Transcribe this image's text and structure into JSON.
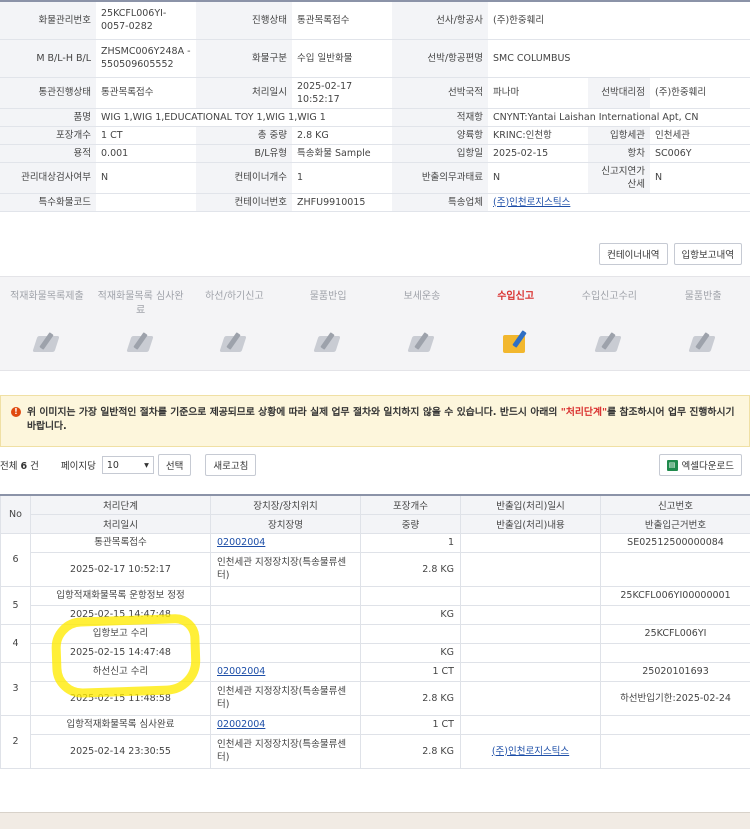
{
  "info": {
    "rows": [
      [
        {
          "l": "화물관리번호",
          "v": "25KCFL006YI-0057-0282"
        },
        {
          "l": "진행상태",
          "v": "통관목록접수"
        },
        {
          "l": "선사/항공사",
          "v": "(주)한중훼리"
        },
        {
          "l": "",
          "v": ""
        }
      ],
      [
        {
          "l": "M B/L-H B/L",
          "v": "ZHSMC006Y248A - 550509605552"
        },
        {
          "l": "화물구분",
          "v": "수입 일반화물"
        },
        {
          "l": "선박/항공편명",
          "v": "SMC COLUMBUS"
        },
        {
          "l": "",
          "v": ""
        }
      ],
      [
        {
          "l": "통관진행상태",
          "v": "통관목록접수"
        },
        {
          "l": "처리일시",
          "v": "2025-02-17 10:52:17"
        },
        {
          "l": "선박국적",
          "v": "파나마"
        },
        {
          "l": "선박대리점",
          "v": "(주)한중훼리"
        }
      ],
      [
        {
          "l": "포장개수",
          "v": "1 CT"
        },
        {
          "l": "총 중량",
          "v": "2.8 KG"
        },
        {
          "l": "양륙항",
          "v": "KRINC:인천항"
        },
        {
          "l": "입항세관",
          "v": "인천세관"
        }
      ],
      [
        {
          "l": "용적",
          "v": "0.001"
        },
        {
          "l": "B/L유형",
          "v": "특송화물 Sample"
        },
        {
          "l": "입항일",
          "v": "2025-02-15"
        },
        {
          "l": "항차",
          "v": "SC006Y"
        }
      ],
      [
        {
          "l": "관리대상검사여부",
          "v": "N"
        },
        {
          "l": "컨테이너개수",
          "v": "1"
        },
        {
          "l": "반출의무과태료",
          "v": "N"
        },
        {
          "l": "신고지연가산세",
          "v": "N"
        }
      ],
      [
        {
          "l": "특수화물코드",
          "v": ""
        },
        {
          "l": "컨테이너번호",
          "v": "ZHFU9910015"
        },
        {
          "l": "특송업체",
          "v": "(주)인천로지스틱스"
        },
        {
          "l": "",
          "v": ""
        }
      ]
    ],
    "product_label": "품명",
    "product_value": "WIG 1,WIG 1,EDUCATIONAL TOY 1,WIG 1,WIG 1",
    "cargo_label": "적재항",
    "cargo_value": "CNYNT:Yantai Laishan International Apt, CN"
  },
  "buttons": {
    "container": "컨테이너내역",
    "arrival": "입항보고내역"
  },
  "steps": [
    {
      "label": "적재화물목록제출",
      "active": false
    },
    {
      "label": "적재화물목록 심사완료",
      "active": false
    },
    {
      "label": "하선/하기신고",
      "active": false
    },
    {
      "label": "물품반입",
      "active": false
    },
    {
      "label": "보세운송",
      "active": false
    },
    {
      "label": "수입신고",
      "active": true
    },
    {
      "label": "수입신고수리",
      "active": false
    },
    {
      "label": "물품반출",
      "active": false
    }
  ],
  "notice": {
    "icon": "!",
    "before": "위 이미지는 가장 일반적인 절차를 기준으로 제공되므로 상황에 따라 실제 업무 절차와 일치하지 않을 수 있습니다. 반드시 아래의 ",
    "emph": "\"처리단계\"",
    "after": "를 참조하시어 업무 진행하시기 바랍니다."
  },
  "toolbar": {
    "total_prefix": "전체 ",
    "total_count": "6",
    "total_suffix": " 건",
    "per_page_label": "페이지당",
    "per_page_value": "10",
    "select_label": "선택",
    "refresh_label": "새로고침",
    "excel_label": "엑셀다운로드"
  },
  "grid": {
    "head1": [
      "No",
      "처리단계",
      "장치장/장치위치",
      "포장개수",
      "반출입(처리)일시",
      "신고번호"
    ],
    "head2": [
      "처리일시",
      "장치장명",
      "중량",
      "반출입(처리)내용",
      "반출입근거번호"
    ],
    "rows": [
      {
        "no": "6",
        "step": "통관목록접수",
        "date": "2025-02-17 10:52:17",
        "loc": "02002004",
        "locname": "인천세관 지정장치장(특송물류센터)",
        "pkg": "1",
        "wt": "2.8 KG",
        "io_dt": "",
        "io": "",
        "decl": "SE02512500000084",
        "basis": ""
      },
      {
        "no": "5",
        "step": "입항적재화물목록 운항정보 정정",
        "date": "2025-02-15 14:47:48",
        "loc": "",
        "locname": "",
        "pkg": "",
        "wt": "KG",
        "io_dt": "",
        "io": "",
        "decl": "25KCFL006YI00000001",
        "basis": ""
      },
      {
        "no": "4",
        "step": "입항보고 수리",
        "date": "2025-02-15 14:47:48",
        "loc": "",
        "locname": "",
        "pkg": "",
        "wt": "KG",
        "io_dt": "",
        "io": "",
        "decl": "25KCFL006YI",
        "basis": ""
      },
      {
        "no": "3",
        "step": "하선신고 수리",
        "date": "2025-02-15 11:48:58",
        "loc": "02002004",
        "locname": "인천세관 지정장치장(특송물류센터)",
        "pkg": "1 CT",
        "wt": "2.8 KG",
        "io_dt": "",
        "io": "",
        "decl": "25020101693",
        "basis": "하선반입기한:2025-02-24"
      },
      {
        "no": "2",
        "step": "입항적재화물목록 심사완료",
        "date": "2025-02-14 23:30:55",
        "loc": "02002004",
        "locname": "인천세관 지정장치장(특송물류센터)",
        "pkg": "1 CT",
        "wt": "2.8 KG",
        "io_dt": "",
        "io": "(주)인천로지스틱스",
        "decl": "",
        "basis": ""
      }
    ]
  },
  "colors": {
    "accent_red": "#d9302f",
    "link": "#1e4fa8",
    "highlight": "#ffeb00",
    "notice_bg": "#fdf6dc"
  }
}
